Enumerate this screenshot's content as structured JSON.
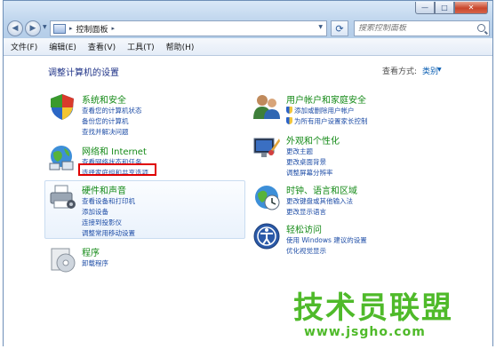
{
  "window": {
    "address": {
      "path_label": "控制面板",
      "sep": "▸"
    },
    "search_placeholder": "搜索控制面板",
    "buttons": {
      "minimize": "—",
      "maximize": "□",
      "close": "✕"
    }
  },
  "menu": [
    "文件(F)",
    "编辑(E)",
    "查看(V)",
    "工具(T)",
    "帮助(H)"
  ],
  "main": {
    "title": "调整计算机的设置",
    "view_by_label": "查看方式:",
    "view_by_value": "类别"
  },
  "categories": {
    "system": {
      "title": "系统和安全",
      "links": [
        "查看您的计算机状态",
        "备份您的计算机",
        "查找并解决问题"
      ]
    },
    "network": {
      "title": "网络和 Internet",
      "links": [
        "查看网络状态和任务",
        "选择家庭组和共享选项"
      ]
    },
    "hardware": {
      "title": "硬件和声音",
      "links": [
        "查看设备和打印机",
        "添加设备",
        "连接到投影仪",
        "调整常用移动设置"
      ]
    },
    "programs": {
      "title": "程序",
      "links": [
        "卸载程序"
      ]
    },
    "users": {
      "title": "用户帐户和家庭安全",
      "links": [
        "添加或删除用户帐户",
        "为所有用户设置家长控制"
      ]
    },
    "appearance": {
      "title": "外观和个性化",
      "links": [
        "更改主题",
        "更改桌面背景",
        "调整屏幕分辨率"
      ]
    },
    "clock": {
      "title": "时钟、语言和区域",
      "links": [
        "更改键盘或其他输入法",
        "更改显示语言"
      ]
    },
    "access": {
      "title": "轻松访问",
      "links": [
        "使用 Windows 建议的设置",
        "优化视觉显示"
      ]
    }
  },
  "watermark": {
    "brand": "技术员联盟",
    "url": "www.jsgho.com"
  },
  "colors": {
    "category_title": "#148a17",
    "link": "#1f4ea7",
    "highlight": "#e00000",
    "watermark": "#4fba2a"
  }
}
